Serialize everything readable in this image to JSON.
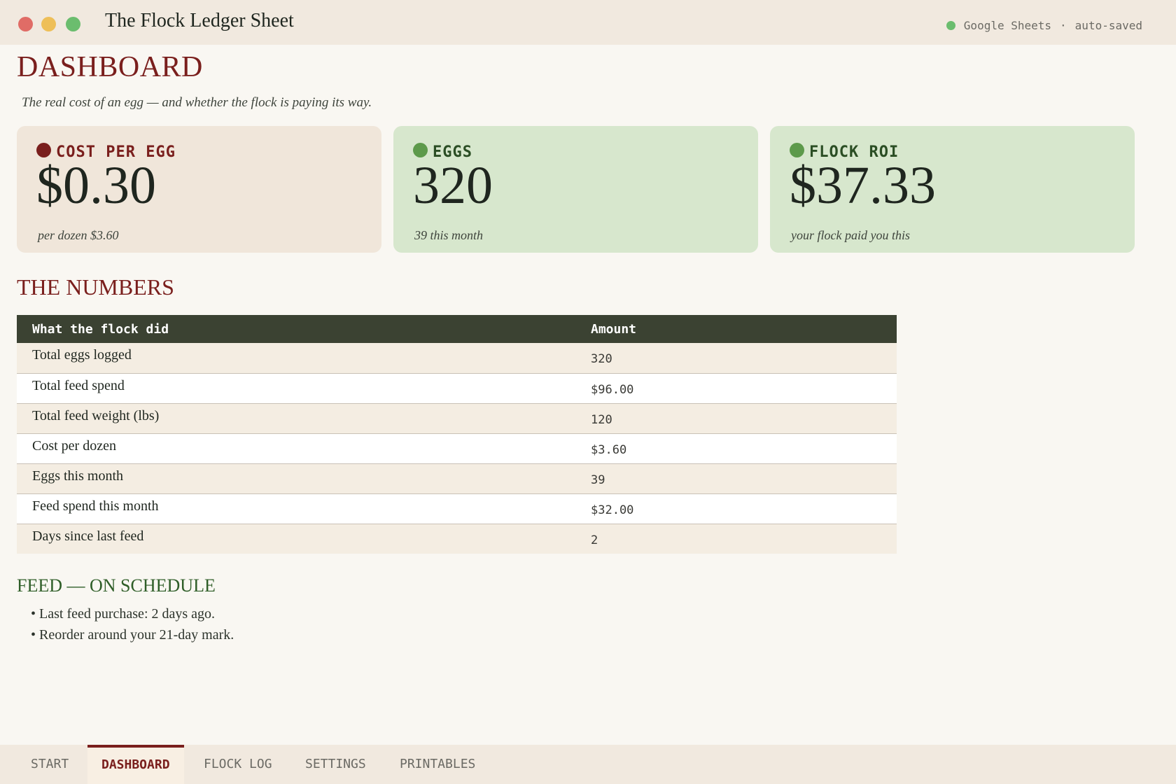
{
  "window": {
    "title": "The Flock Ledger Sheet",
    "status_app": "Google Sheets",
    "status_sep": "·",
    "status_saved": "auto-saved"
  },
  "page": {
    "title": "DASHBOARD",
    "subtitle": "The real cost of an egg — and whether the flock is paying its way."
  },
  "cards": [
    {
      "label": "COST PER EGG",
      "value": "$0.30",
      "foot": "per dozen  $3.60",
      "color": "#7a1f1d"
    },
    {
      "label": "EGGS",
      "value": "320",
      "foot": "39 this month",
      "color": "#5d9a4b"
    },
    {
      "label": "FLOCK ROI",
      "value": "$37.33",
      "foot": "your flock paid you this",
      "color": "#5d9a4b"
    }
  ],
  "numbers": {
    "title": "THE NUMBERS",
    "columns": [
      "What the flock did",
      "Amount"
    ],
    "rows": [
      [
        "Total eggs logged",
        "320"
      ],
      [
        "Total feed spend",
        "$96.00"
      ],
      [
        "Total feed weight (lbs)",
        "120"
      ],
      [
        "Cost per dozen",
        "$3.60"
      ],
      [
        "Eggs this month",
        "39"
      ],
      [
        "Feed spend this month",
        "$32.00"
      ],
      [
        "Days since last feed",
        "2"
      ]
    ]
  },
  "feed": {
    "title": "FEED — ON SCHEDULE",
    "items": [
      "Last feed purchase: 2 days ago.",
      "Reorder around your 21-day mark."
    ]
  },
  "tabs": [
    {
      "label": "START",
      "active": false
    },
    {
      "label": "DASHBOARD",
      "active": true
    },
    {
      "label": "FLOCK LOG",
      "active": false
    },
    {
      "label": "SETTINGS",
      "active": false
    },
    {
      "label": "PRINTABLES",
      "active": false
    }
  ],
  "colors": {
    "accent": "#7a1f1d",
    "green": "#5d9a4b",
    "header_dark": "#3b4232"
  }
}
